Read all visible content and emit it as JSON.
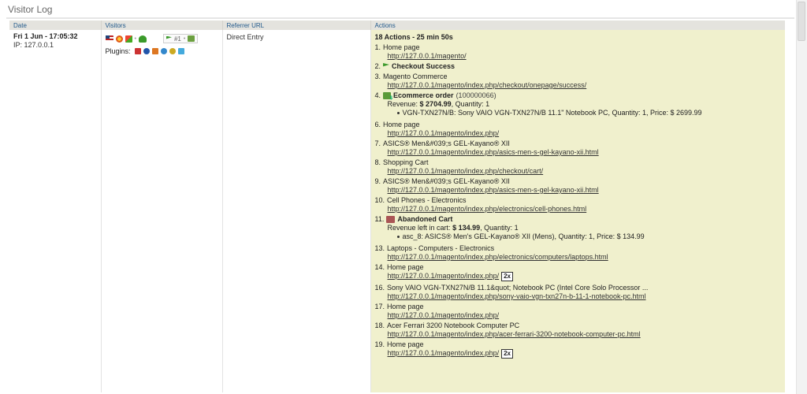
{
  "widget": {
    "title": "Visitor Log"
  },
  "columns": {
    "date": "Date",
    "visitors": "Visitors",
    "referrer": "Referrer URL",
    "actions": "Actions"
  },
  "visit": {
    "date": "Fri 1 Jun - 17:05:32",
    "ip": "IP: 127.0.0.1",
    "goal_label": "#1",
    "plugins_label": "Plugins:",
    "referrer": "Direct Entry",
    "summary": "18 Actions - 25 min 50s"
  },
  "actions": [
    {
      "n": "1.",
      "title": "Home page",
      "url": "http://127.0.0.1/magento/"
    },
    {
      "n": "2.",
      "title": "Checkout Success"
    },
    {
      "n": "3.",
      "title": "Magento Commerce",
      "url": "http://127.0.0.1/magento/index.php/checkout/onepage/success/"
    },
    {
      "n": "4.",
      "title": "Ecommerce order",
      "order_id": "(100000066)",
      "revenue_prefix": "Revenue:",
      "revenue": "$ 2704.99",
      "quantity": ", Quantity: 1",
      "item": "VGN-TXN27N/B: Sony VAIO VGN-TXN27N/B 11.1\" Notebook PC, Quantity: 1, Price: $ 2699.99"
    },
    {
      "n": "6.",
      "title": "Home page",
      "url": "http://127.0.0.1/magento/index.php/"
    },
    {
      "n": "7.",
      "title": "ASICS® Men&#039;s GEL-Kayano® XII",
      "url": "http://127.0.0.1/magento/index.php/asics-men-s-gel-kayano-xii.html"
    },
    {
      "n": "8.",
      "title": "Shopping Cart",
      "url": "http://127.0.0.1/magento/index.php/checkout/cart/"
    },
    {
      "n": "9.",
      "title": "ASICS® Men&#039;s GEL-Kayano® XII",
      "url": "http://127.0.0.1/magento/index.php/asics-men-s-gel-kayano-xii.html"
    },
    {
      "n": "10.",
      "title": "Cell Phones - Electronics",
      "url": "http://127.0.0.1/magento/index.php/electronics/cell-phones.html"
    },
    {
      "n": "11.",
      "title": "Abandoned Cart",
      "revenue_prefix": "Revenue left in cart:",
      "revenue": "$ 134.99",
      "quantity": ", Quantity: 1",
      "item": "asc_8: ASICS® Men's GEL-Kayano® XII (Mens), Quantity: 1, Price: $ 134.99"
    },
    {
      "n": "13.",
      "title": "Laptops - Computers - Electronics",
      "url": "http://127.0.0.1/magento/index.php/electronics/computers/laptops.html"
    },
    {
      "n": "14.",
      "title": "Home page",
      "url": "http://127.0.0.1/magento/index.php/",
      "repeat": "2x"
    },
    {
      "n": "16.",
      "title": "Sony VAIO VGN-TXN27N/B 11.1&quot; Notebook PC (Intel Core Solo Processor ...",
      "url": "http://127.0.0.1/magento/index.php/sony-vaio-vgn-txn27n-b-11-1-notebook-pc.html"
    },
    {
      "n": "17.",
      "title": "Home page",
      "url": "http://127.0.0.1/magento/index.php/"
    },
    {
      "n": "18.",
      "title": "Acer Ferrari 3200 Notebook Computer PC",
      "url": "http://127.0.0.1/magento/index.php/acer-ferrari-3200-notebook-computer-pc.html"
    },
    {
      "n": "19.",
      "title": "Home page",
      "url": "http://127.0.0.1/magento/index.php/",
      "repeat": "2x"
    }
  ]
}
